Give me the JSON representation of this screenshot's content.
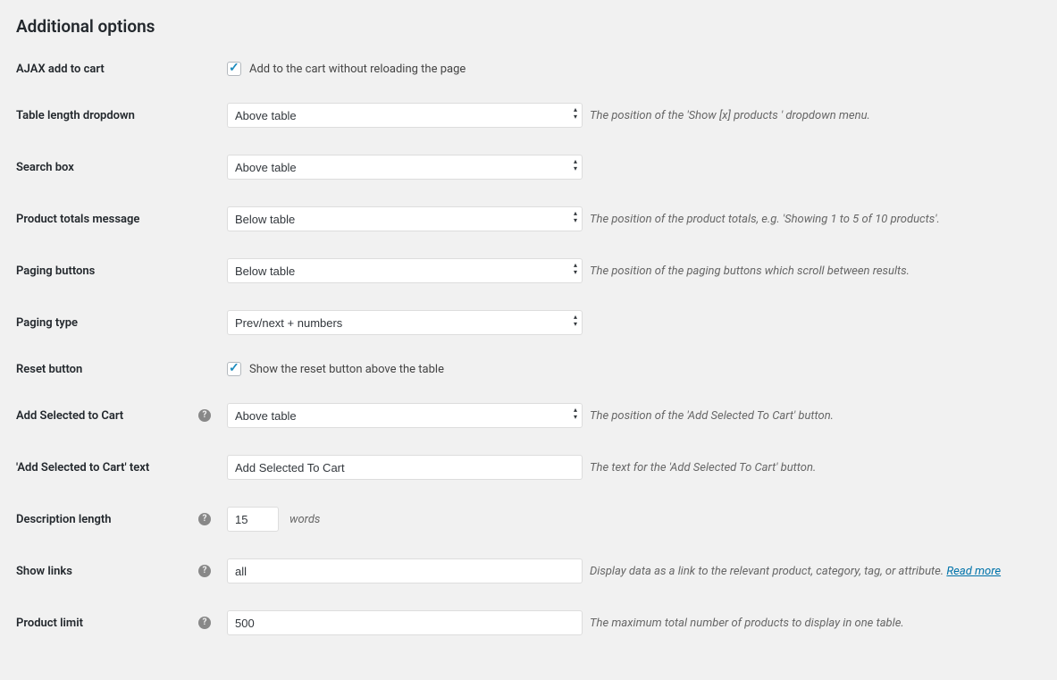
{
  "heading": "Additional options",
  "ajax_add_to_cart": {
    "label": "AJAX add to cart",
    "checkbox_label": "Add to the cart without reloading the page"
  },
  "table_length_dropdown": {
    "label": "Table length dropdown",
    "value": "Above table",
    "description": "The position of the 'Show [x] products ' dropdown menu."
  },
  "search_box": {
    "label": "Search box",
    "value": "Above table"
  },
  "product_totals_message": {
    "label": "Product totals message",
    "value": "Below table",
    "description": "The position of the product totals, e.g. 'Showing 1 to 5 of 10 products'."
  },
  "paging_buttons": {
    "label": "Paging buttons",
    "value": "Below table",
    "description": "The position of the paging buttons which scroll between results."
  },
  "paging_type": {
    "label": "Paging type",
    "value": "Prev/next + numbers"
  },
  "reset_button": {
    "label": "Reset button",
    "checkbox_label": "Show the reset button above the table"
  },
  "add_selected_to_cart": {
    "label": "Add Selected to Cart",
    "value": "Above table",
    "description": "The position of the 'Add Selected To Cart' button."
  },
  "add_selected_to_cart_text": {
    "label": "'Add Selected to Cart' text",
    "value": "Add Selected To Cart",
    "description": "The text for the 'Add Selected To Cart' button."
  },
  "description_length": {
    "label": "Description length",
    "value": "15",
    "suffix": "words"
  },
  "show_links": {
    "label": "Show links",
    "value": "all",
    "description": "Display data as a link to the relevant product, category, tag, or attribute. ",
    "link_text": "Read more"
  },
  "product_limit": {
    "label": "Product limit",
    "value": "500",
    "description": "The maximum total number of products to display in one table."
  }
}
